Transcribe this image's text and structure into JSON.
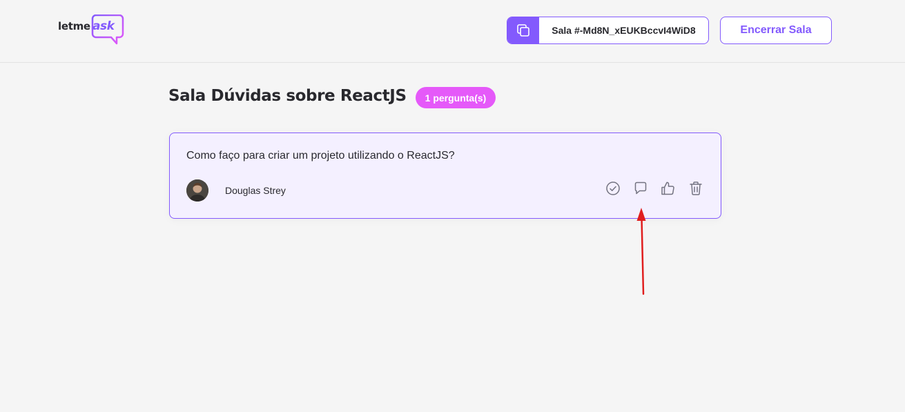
{
  "header": {
    "logo": {
      "part1": "letme",
      "part2": "ask"
    },
    "room_code": {
      "label": "Sala #-Md8N_xEUKBccvI4WiD8",
      "icon": "copy-icon"
    },
    "close_room_label": "Encerrar Sala"
  },
  "room": {
    "title": "Sala Dúvidas sobre ReactJS",
    "question_count_badge": "1 pergunta(s)"
  },
  "questions": [
    {
      "content": "Como faço para criar um projeto utilizando o ReactJS?",
      "author": "Douglas Strey",
      "actions": [
        "check-circle-icon",
        "answer-icon",
        "like-icon",
        "trash-icon"
      ]
    }
  ],
  "colors": {
    "accent": "#835afd",
    "badge": "#e559f9",
    "card_bg": "#f4f0ff",
    "annotation": "#e01e1e"
  }
}
